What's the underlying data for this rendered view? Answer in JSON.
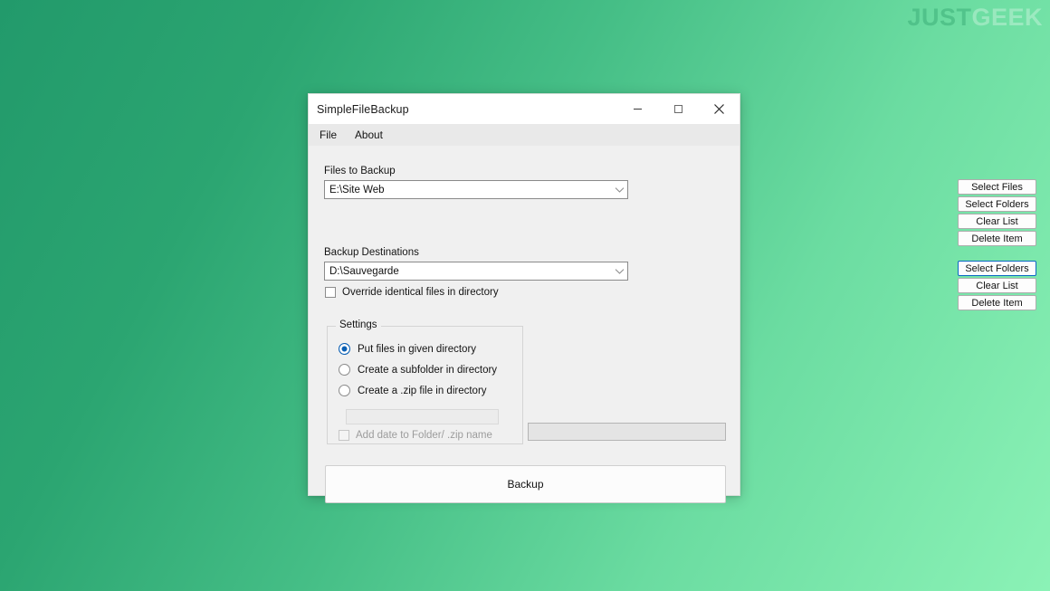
{
  "desktop": {
    "watermark": {
      "part1": "JUST",
      "part2": "GEEK"
    },
    "background_from": "#229A6B",
    "background_to": "#8BF2B6"
  },
  "window": {
    "title": "SimpleFileBackup",
    "controls": {
      "minimize": "minimize-icon",
      "maximize": "maximize-icon",
      "close": "close-icon"
    }
  },
  "menu": {
    "items": [
      {
        "label": "File"
      },
      {
        "label": "About"
      }
    ]
  },
  "files_to_backup": {
    "label": "Files to Backup",
    "value": "E:\\Site Web",
    "arrow_icon": "chevron-down-icon",
    "buttons": [
      {
        "label": "Select Files",
        "focused": false
      },
      {
        "label": "Select Folders",
        "focused": false
      },
      {
        "label": "Clear List",
        "focused": false
      },
      {
        "label": "Delete Item",
        "focused": false
      }
    ]
  },
  "backup_destinations": {
    "label": "Backup Destinations",
    "value": "D:\\Sauvegarde",
    "arrow_icon": "chevron-down-icon",
    "buttons": [
      {
        "label": "Select Folders",
        "focused": true
      },
      {
        "label": "Clear List",
        "focused": false
      },
      {
        "label": "Delete Item",
        "focused": false
      }
    ]
  },
  "override_checkbox": {
    "label": "Override identical files in directory",
    "checked": false
  },
  "settings": {
    "legend": "Settings",
    "options": [
      {
        "label": "Put files in given directory",
        "selected": true
      },
      {
        "label": "Create a subfolder in directory",
        "selected": false
      },
      {
        "label": "Create a .zip file in directory",
        "selected": false
      }
    ],
    "name_input_value": "",
    "add_date_checkbox": {
      "label": "Add date to Folder/ .zip name",
      "checked": false,
      "disabled": true
    }
  },
  "status_field": {
    "value": ""
  },
  "backup_button": {
    "label": "Backup"
  },
  "colors": {
    "accent_blue": "#0A5FB4",
    "focus_blue": "#0A66C2",
    "window_bg": "#F0F0F0",
    "titlebar_bg": "#FFFFFF",
    "menubar_bg": "#E9E9E9"
  }
}
